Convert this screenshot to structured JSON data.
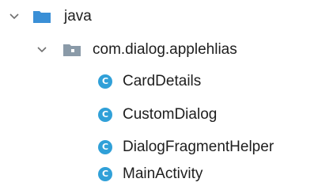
{
  "tree": {
    "root": {
      "label": "java",
      "icon": "folder-icon",
      "expanded": true
    },
    "package": {
      "label": "com.dialog.applehlias",
      "icon": "package-folder-icon",
      "expanded": true
    },
    "classes": [
      {
        "label": "CardDetails",
        "icon": "class-icon",
        "glyph": "C"
      },
      {
        "label": "CustomDialog",
        "icon": "class-icon",
        "glyph": "C"
      },
      {
        "label": "DialogFragmentHelper",
        "icon": "class-icon",
        "glyph": "C"
      },
      {
        "label": "MainActivity",
        "icon": "class-icon",
        "glyph": "C"
      }
    ]
  },
  "colors": {
    "folder_blue": "#3a8fd6",
    "package_gray": "#8a9aa8",
    "class_badge": "#30a0d8",
    "chevron": "#6f6f6f",
    "text": "#1e1e1e"
  }
}
